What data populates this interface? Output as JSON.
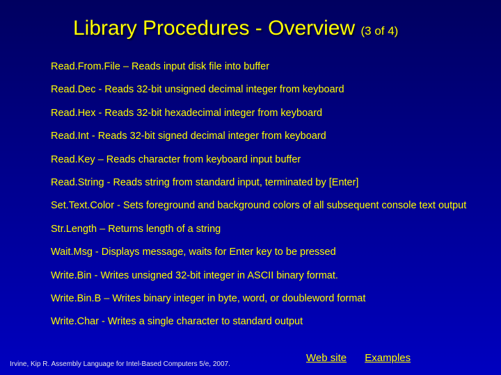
{
  "title": {
    "main": "Library Procedures - Overview",
    "sub": "(3 of 4)"
  },
  "items": [
    "Read.From.File – Reads input disk file into buffer",
    "Read.Dec - Reads 32-bit unsigned decimal integer from keyboard",
    "Read.Hex - Reads 32-bit hexadecimal integer from keyboard",
    "Read.Int - Reads 32-bit signed decimal integer from keyboard",
    "Read.Key – Reads character from keyboard input buffer",
    "Read.String - Reads string from standard input, terminated by [Enter]",
    "Set.Text.Color - Sets foreground and background colors of all subsequent console text output",
    "Str.Length – Returns length of a string",
    "Wait.Msg - Displays message, waits for Enter key to be pressed",
    "Write.Bin - Writes unsigned 32-bit integer in ASCII binary format.",
    "Write.Bin.B – Writes binary integer in byte, word, or doubleword format",
    "Write.Char - Writes a single character to standard output"
  ],
  "footer": "Irvine, Kip R. Assembly Language for Intel-Based Computers 5/e, 2007.",
  "links": {
    "website": "Web site",
    "examples": "Examples"
  }
}
